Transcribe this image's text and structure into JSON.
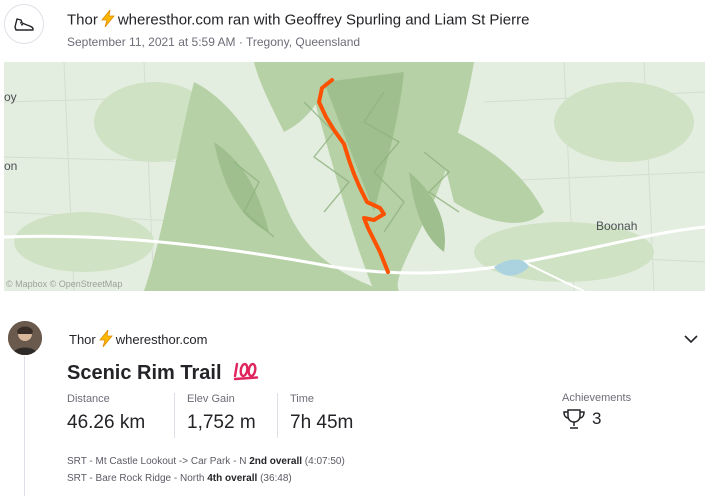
{
  "group": {
    "athlete": "Thor",
    "site": "wheresthor.com",
    "ran_with_text": "ran with Geoffrey Spurling and Liam St Pierre",
    "datetime_location": "September 11, 2021 at 5:59 AM · Tregony, Queensland",
    "icon": "running-shoe-icon"
  },
  "map": {
    "labels": {
      "left_top": "oy",
      "left_mid": "on",
      "town": "Boonah"
    },
    "attribution": "© Mapbox © OpenStreetMap",
    "route_color": "#fc5200"
  },
  "activity": {
    "athlete": "Thor",
    "site": "wheresthor.com",
    "title": "Scenic Rim Trail",
    "title_emoji": "💯",
    "stats": [
      {
        "label": "Distance",
        "value": "46.26 km"
      },
      {
        "label": "Elev Gain",
        "value": "1,752 m"
      },
      {
        "label": "Time",
        "value": "7h 45m"
      }
    ],
    "achievements": {
      "label": "Achievements",
      "count": "3"
    },
    "segments": [
      {
        "name": "SRT - Mt Castle Lookout -> Car Park - N",
        "rank": "2nd overall",
        "time": "(4:07:50)"
      },
      {
        "name": "SRT - Bare Rock Ridge - North",
        "rank": "4th overall",
        "time": "(36:48)"
      }
    ]
  },
  "colors": {
    "bolt": "#fc5200",
    "text": "#242428",
    "muted": "#6d6d78"
  }
}
